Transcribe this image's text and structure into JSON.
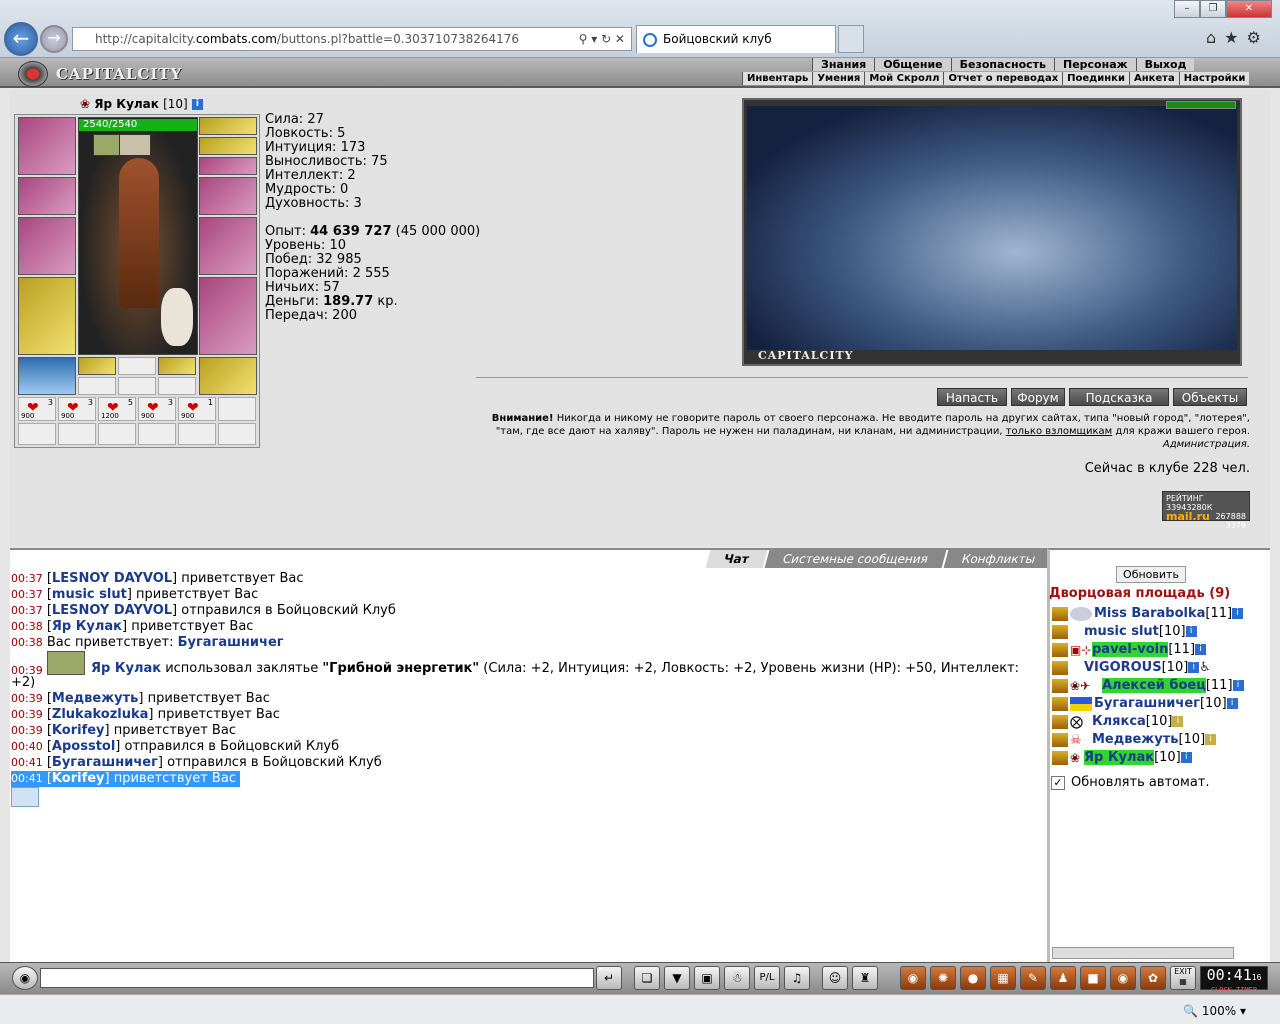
{
  "browser": {
    "url_prefix": "http://capitalcity.",
    "url_domain": "combats.com",
    "url_suffix": "/buttons.pl?battle=0.303710738264176",
    "tab_title": "Бойцовский клуб",
    "zoom": "100%"
  },
  "header": {
    "logo": "CAPITALCITY",
    "menu_top": [
      "Знания",
      "Общение",
      "Безопасность",
      "Персонаж",
      "Выход"
    ],
    "menu_sub": [
      "Инвентарь",
      "Умения",
      "Мой Скролл",
      "Отчет о переводах",
      "Поединки",
      "Анкета",
      "Настройки"
    ]
  },
  "character": {
    "name": "Яр Кулак",
    "level": "[10]",
    "hp": "2540/2540",
    "stats": {
      "strength": "Сила: 27",
      "agility": "Ловкость: 5",
      "intuition": "Интуиция: 173",
      "endurance": "Выносливость: 75",
      "intellect": "Интеллект: 2",
      "wisdom": "Мудрость: 0",
      "spirit": "Духовность: 3"
    },
    "exp_label": "Опыт: ",
    "exp_value": "44 639 727",
    "exp_next": " (45 000 000)",
    "level_line": "Уровень: 10",
    "wins": "Побед: 32 985",
    "losses": "Поражений: 2 555",
    "draws": "Ничьих: 57",
    "money_label": "Деньги: ",
    "money_value": "189.77",
    "money_unit": " кр.",
    "transfers": "Передач: 200",
    "potion_counts": [
      "3",
      "3",
      "5",
      "3",
      "1"
    ],
    "potion_sub": [
      "900",
      "900",
      "1200",
      "900",
      "900"
    ]
  },
  "scene": {
    "caption": "CAPITALCITY"
  },
  "actions": [
    "Напасть",
    "Форум",
    "Подсказка",
    "Объекты"
  ],
  "warning": {
    "bold": "Внимание!",
    "text1": " Никогда и никому не говорите пароль от своего персонажа. Не вводите пароль на других сайтах, типа \"новый город\", \"лотерея\", \"там, где все дают на халяву\". Пароль не нужен ни паладинам, ни кланам, ни администрации, ",
    "link": "только взломщикам",
    "text2": " для кражи вашего героя.",
    "sign": "Администрация."
  },
  "online": "Сейчас в клубе 228 чел.",
  "rating": {
    "line1": "РЕЙТИНГ 33943280К",
    "line2": "267888",
    "line3": "3379",
    "brand": "mail.ru"
  },
  "chat_tabs": [
    "Чат",
    "Системные сообщения",
    "Конфликты"
  ],
  "chat": [
    {
      "t": "00:37",
      "nick": "LESNOY DAYVOL",
      "msg": " приветствует Вас"
    },
    {
      "t": "00:37",
      "nick": "music slut",
      "msg": " приветствует Вас"
    },
    {
      "t": "00:37",
      "nick": "LESNOY DAYVOL",
      "msg": " отправился в Бойцовский Клуб"
    },
    {
      "t": "00:38",
      "nick": "Яр Кулак",
      "msg": " приветствует Вас"
    },
    {
      "t": "00:38",
      "pre": "Вас приветствует: ",
      "nick2": "Бугагашничег"
    },
    {
      "t": "00:39",
      "spell_actor": "Яр Кулак",
      "spell_pre": " использовал заклятье ",
      "spell_name": "\"Грибной энергетик\"",
      "spell_post": " (Сила: +2, Интуиция: +2, Ловкость: +2, Уровень жизни (HP): +50, Интеллект:",
      "spell_wrap": "+2)"
    },
    {
      "t": "00:39",
      "nick": "Медвежуть",
      "msg": " приветствует Вас"
    },
    {
      "t": "00:39",
      "nick": "Zlukakozluka",
      "msg": " приветствует Вас"
    },
    {
      "t": "00:39",
      "nick": "Korifey",
      "msg": " приветствует Вас"
    },
    {
      "t": "00:40",
      "nick": "Aposstol",
      "msg": " отправился в Бойцовский Клуб"
    },
    {
      "t": "00:41",
      "nick": "Бугагашничег",
      "msg": " отправился в Бойцовский Клуб"
    },
    {
      "t": "00:41",
      "nick": "Korifey",
      "msg": " приветствует Вас"
    }
  ],
  "room": {
    "refresh": "Обновить",
    "title": "Дворцовая площадь (9)",
    "users": [
      {
        "name": "Miss Barabolka",
        "lvl": "[11]"
      },
      {
        "name": "music slut",
        "lvl": "[10]"
      },
      {
        "name": "pavel-voin",
        "lvl": "[11]"
      },
      {
        "name": "VIGOROUS",
        "lvl": "[10]"
      },
      {
        "name": "Алексей боец",
        "lvl": "[11]"
      },
      {
        "name": "Бугагашничег",
        "lvl": "[10]"
      },
      {
        "name": "Клякса",
        "lvl": "[10]"
      },
      {
        "name": "Медвежуть",
        "lvl": "[10]"
      },
      {
        "name": "Яр Кулак",
        "lvl": "[10]"
      }
    ],
    "auto_refresh": "Обновлять автомат."
  },
  "clock": {
    "time": "00:41",
    "sec": "16",
    "labels": "CLOCK TIMER"
  }
}
